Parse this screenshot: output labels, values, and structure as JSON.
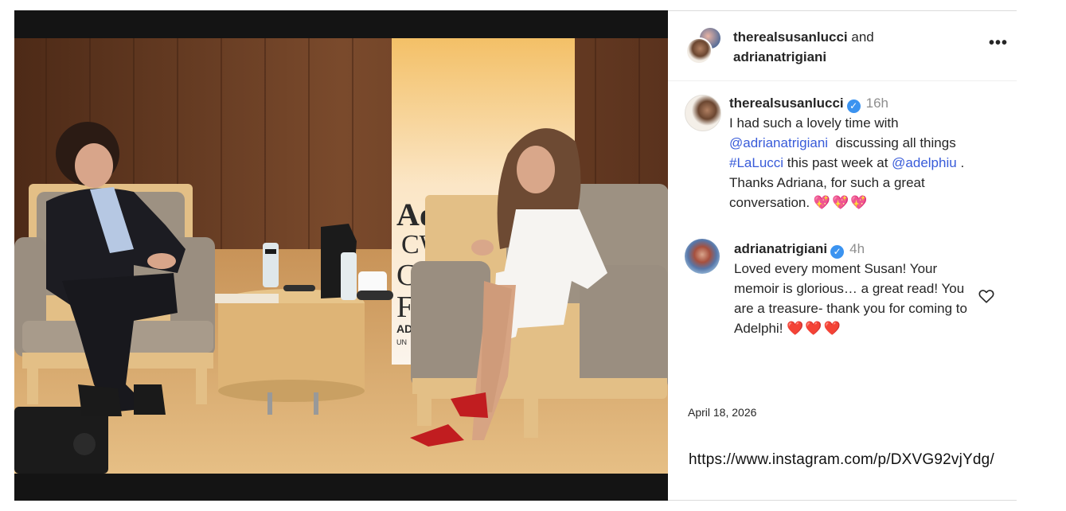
{
  "post": {
    "photo_alt": "",
    "header": {
      "user1": "therealsusanlucci",
      "and_text": "and",
      "user2": "adrianatrigiani",
      "more_icon": "more-horizontal-icon",
      "more_label": "•••"
    },
    "comments": [
      {
        "user": "therealsusanlucci",
        "verified": true,
        "time": "16h",
        "text_parts": {
          "line1": "I had such a lovely time with",
          "mention1": "@adrianatrigiani",
          "mid1": "discussing all things",
          "hashtag": "#LaLucci",
          "mid2": "this past week at",
          "mention2": "@adelphiu",
          "end": ".",
          "thanks": "Thanks Adriana, for such a great conversation.",
          "emoji": "💖💖💖"
        }
      },
      {
        "user": "adrianatrigiani",
        "verified": true,
        "time": "4h",
        "text": "Loved every moment Susan! Your memoir is glorious… a great read! You are a treasure- thank you for coming to Adelphi!",
        "emoji": "❤️❤️❤️",
        "like_icon": "heart-outline-icon"
      }
    ],
    "date": "April 18, 2026",
    "url": "https://www.instagram.com/p/DXVG92vjYdg/"
  },
  "stage": {
    "banner_text": "Adelphi",
    "banner_sub": "CWriter",
    "banner_letters": [
      "C",
      "F"
    ],
    "banner_tag": "AD",
    "banner_tag2": "UN"
  },
  "colors": {
    "mention": "#385bd9",
    "verified": "#3b93f0",
    "muted": "#8e8e8e"
  }
}
